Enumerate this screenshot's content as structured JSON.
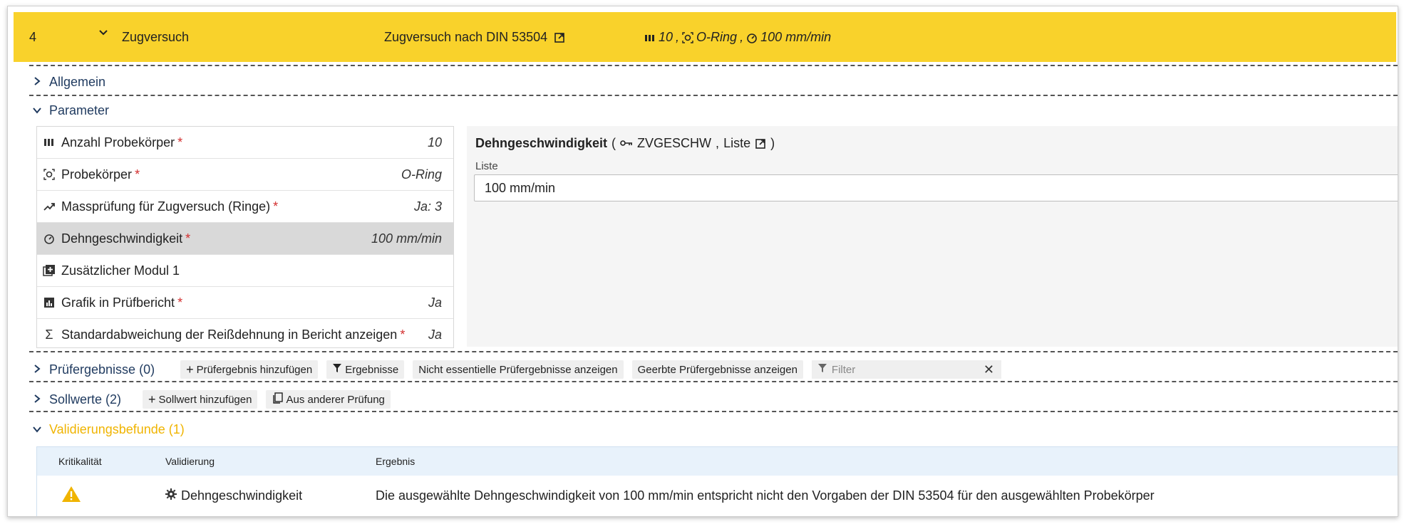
{
  "header": {
    "number": "4",
    "title": "Zugversuch",
    "norm": "Zugversuch nach DIN 53504",
    "summary": {
      "count": "10",
      "specimen": "O-Ring",
      "speed": "100 mm/min"
    }
  },
  "sections": {
    "allgemein": "Allgemein",
    "parameter": "Parameter",
    "pruefergebnisse": "Prüfergebnisse (0)",
    "sollwerte": "Sollwerte (2)",
    "validierung": "Validierungsbefunde (1)"
  },
  "parameters": [
    {
      "label": "Anzahl Probekörper",
      "value": "10",
      "required": true,
      "icon": "bars-icon"
    },
    {
      "label": "Probekörper",
      "value": "O-Ring",
      "required": true,
      "icon": "specimen-icon"
    },
    {
      "label": "Massprüfung für Zugversuch (Ringe)",
      "value": "Ja: 3",
      "required": true,
      "icon": "trend-icon"
    },
    {
      "label": "Dehngeschwindigkeit",
      "value": "100 mm/min",
      "required": true,
      "icon": "gauge-icon",
      "selected": true
    },
    {
      "label": "Zusätzlicher Modul 1",
      "value": "",
      "required": false,
      "icon": "add-module-icon"
    },
    {
      "label": "Grafik in Prüfbericht",
      "value": "Ja",
      "required": true,
      "icon": "chart-icon"
    },
    {
      "label": "Standardabweichung der Reißdehnung in Bericht anzeigen",
      "value": "Ja",
      "required": true,
      "icon": "sigma-icon"
    }
  ],
  "required_mark": "*",
  "detail": {
    "title": "Dehngeschwindigkeit",
    "key": "ZVGESCHW",
    "list_link": "Liste",
    "field_label": "Liste",
    "field_value": "100 mm/min",
    "open_paren": "(",
    "close_paren": ")",
    "comma": ","
  },
  "toolbar_results": {
    "add": "Prüfergebnis hinzufügen",
    "filter_results": "Ergebnisse",
    "non_essential": "Nicht essentielle Prüfergebnisse anzeigen",
    "inherited": "Geerbte Prüfergebnisse anzeigen",
    "filter_placeholder": "Filter"
  },
  "toolbar_targets": {
    "add": "Sollwert hinzufügen",
    "from_other": "Aus anderer Prüfung"
  },
  "validation_table": {
    "columns": [
      "Kritikalität",
      "Validierung",
      "Ergebnis"
    ],
    "rows": [
      {
        "severity": "warning-icon",
        "validation": "Dehngeschwindigkeit",
        "result": "Die ausgewählte Dehngeschwindigkeit von 100 mm/min entspricht nicht den Vorgaben der DIN 53504 für den ausgewählten Probekörper"
      }
    ]
  },
  "colors": {
    "header_bg": "#f9d22b",
    "accent": "#f0b400",
    "selected_row": "#d9d9d9"
  }
}
